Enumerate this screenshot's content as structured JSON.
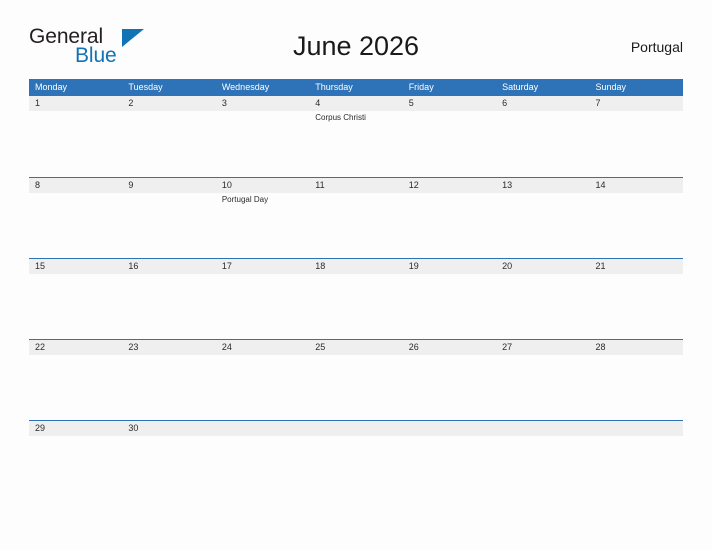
{
  "brand": {
    "name_part1": "General",
    "name_part2": "Blue",
    "accent_color": "#1272b6"
  },
  "header": {
    "title": "June 2026",
    "locale": "Portugal"
  },
  "calendar": {
    "header_bg_color": "#2e73b8",
    "day_band_color": "#efefef",
    "weekdays": [
      "Monday",
      "Tuesday",
      "Wednesday",
      "Thursday",
      "Friday",
      "Saturday",
      "Sunday"
    ],
    "weeks": [
      {
        "days": [
          {
            "number": "1",
            "events": []
          },
          {
            "number": "2",
            "events": []
          },
          {
            "number": "3",
            "events": []
          },
          {
            "number": "4",
            "events": [
              "Corpus Christi"
            ]
          },
          {
            "number": "5",
            "events": []
          },
          {
            "number": "6",
            "events": []
          },
          {
            "number": "7",
            "events": []
          }
        ]
      },
      {
        "days": [
          {
            "number": "8",
            "events": []
          },
          {
            "number": "9",
            "events": []
          },
          {
            "number": "10",
            "events": [
              "Portugal Day"
            ]
          },
          {
            "number": "11",
            "events": []
          },
          {
            "number": "12",
            "events": []
          },
          {
            "number": "13",
            "events": []
          },
          {
            "number": "14",
            "events": []
          }
        ]
      },
      {
        "days": [
          {
            "number": "15",
            "events": []
          },
          {
            "number": "16",
            "events": []
          },
          {
            "number": "17",
            "events": []
          },
          {
            "number": "18",
            "events": []
          },
          {
            "number": "19",
            "events": []
          },
          {
            "number": "20",
            "events": []
          },
          {
            "number": "21",
            "events": []
          }
        ]
      },
      {
        "days": [
          {
            "number": "22",
            "events": []
          },
          {
            "number": "23",
            "events": []
          },
          {
            "number": "24",
            "events": []
          },
          {
            "number": "25",
            "events": []
          },
          {
            "number": "26",
            "events": []
          },
          {
            "number": "27",
            "events": []
          },
          {
            "number": "28",
            "events": []
          }
        ]
      },
      {
        "days": [
          {
            "number": "29",
            "events": []
          },
          {
            "number": "30",
            "events": []
          },
          {
            "number": "",
            "events": []
          },
          {
            "number": "",
            "events": []
          },
          {
            "number": "",
            "events": []
          },
          {
            "number": "",
            "events": []
          },
          {
            "number": "",
            "events": []
          }
        ]
      }
    ]
  }
}
